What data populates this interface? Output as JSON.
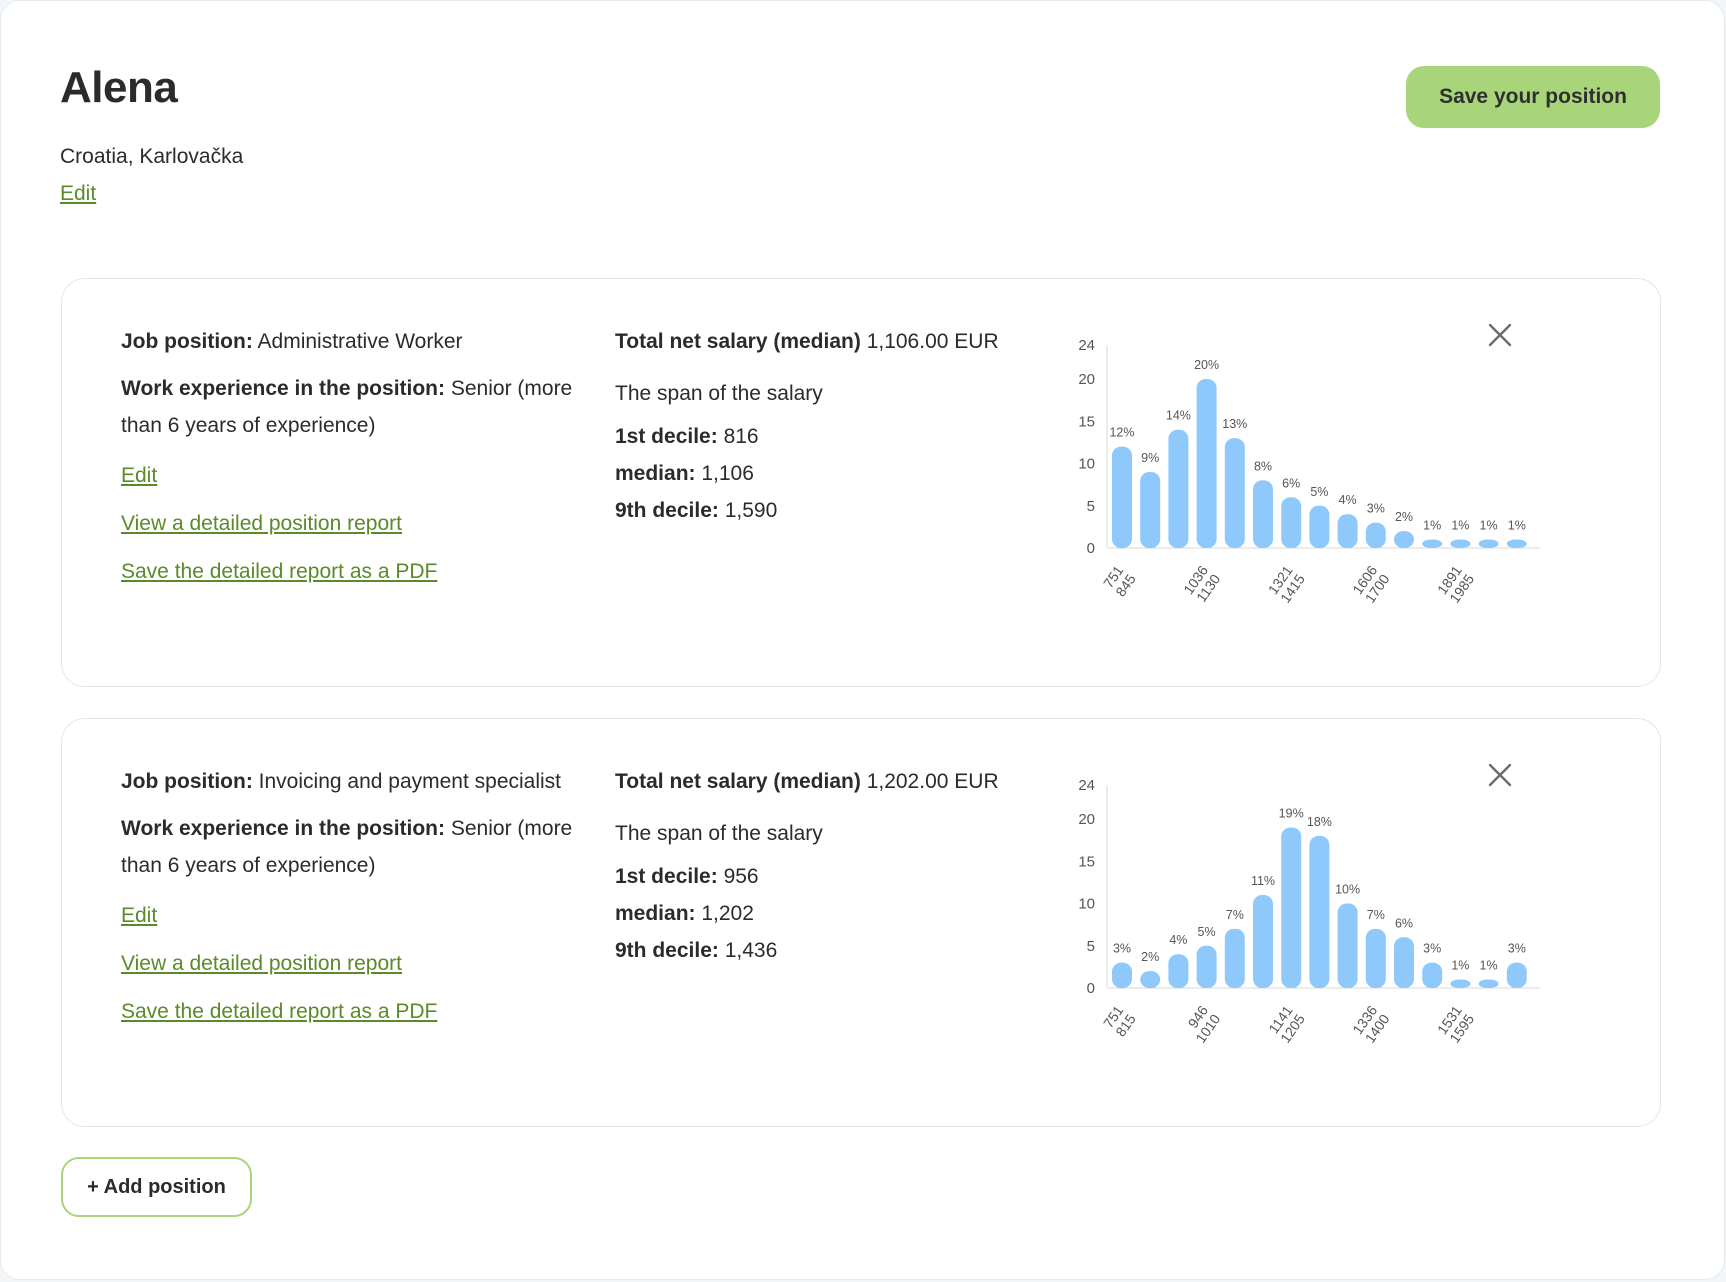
{
  "profile": {
    "name": "Alena",
    "location": "Croatia, Karlovačka",
    "edit_label": "Edit",
    "save_label": "Save your position"
  },
  "positions": [
    {
      "job_label": "Job position:",
      "job_value": "Administrative Worker",
      "exp_label": "Work experience in the position:",
      "exp_value": "Senior (more than 6 years of experience)",
      "edit_label": "Edit",
      "view_report_label": "View a detailed position report",
      "save_pdf_label": "Save the detailed report as a PDF",
      "median_label": "Total net salary (median)",
      "median_value": "1,106.00 EUR",
      "span_title": "The span of the salary",
      "decile1_label": "1st decile:",
      "decile1_value": "816",
      "median2_label": "median:",
      "median2_value": "1,106",
      "decile9_label": "9th decile:",
      "decile9_value": "1,590"
    },
    {
      "job_label": "Job position:",
      "job_value": "Invoicing and payment specialist",
      "exp_label": "Work experience in the position:",
      "exp_value": "Senior (more than 6 years of experience)",
      "edit_label": "Edit",
      "view_report_label": "View a detailed position report",
      "save_pdf_label": "Save the detailed report as a PDF",
      "median_label": "Total net salary (median)",
      "median_value": "1,202.00 EUR",
      "span_title": "The span of the salary",
      "decile1_label": "1st decile:",
      "decile1_value": "956",
      "median2_label": "median:",
      "median2_value": "1,202",
      "decile9_label": "9th decile:",
      "decile9_value": "1,436"
    }
  ],
  "add_position_label": "+ Add position",
  "icons": {
    "close": "close-icon"
  },
  "colors": {
    "accent": "#a9d57a",
    "link": "#5a8a2a",
    "bar": "#8fc8fb"
  },
  "chart_data": [
    {
      "type": "bar",
      "ylim": [
        0,
        24
      ],
      "yticks": [
        0,
        5,
        10,
        15,
        20,
        24
      ],
      "values": [
        12,
        9,
        14,
        20,
        13,
        8,
        6,
        5,
        4,
        3,
        2,
        1,
        1,
        1,
        1
      ],
      "labels": [
        "12%",
        "9%",
        "14%",
        "20%",
        "13%",
        "8%",
        "6%",
        "5%",
        "4%",
        "3%",
        "2%",
        "1%",
        "1%",
        "1%",
        "1%"
      ],
      "xticks": [
        {
          "index": 0,
          "lines": [
            "751",
            "845"
          ]
        },
        {
          "index": 3,
          "lines": [
            "1036",
            "1130"
          ]
        },
        {
          "index": 6,
          "lines": [
            "1321",
            "1415"
          ]
        },
        {
          "index": 9,
          "lines": [
            "1606",
            "1700"
          ]
        },
        {
          "index": 12,
          "lines": [
            "1891",
            "1985"
          ]
        }
      ]
    },
    {
      "type": "bar",
      "ylim": [
        0,
        24
      ],
      "yticks": [
        0,
        5,
        10,
        15,
        20,
        24
      ],
      "values": [
        3,
        2,
        4,
        5,
        7,
        11,
        19,
        18,
        10,
        7,
        6,
        3,
        1,
        1,
        3
      ],
      "labels": [
        "3%",
        "2%",
        "4%",
        "5%",
        "7%",
        "11%",
        "19%",
        "18%",
        "10%",
        "7%",
        "6%",
        "3%",
        "1%",
        "1%",
        "3%"
      ],
      "xticks": [
        {
          "index": 0,
          "lines": [
            "751",
            "815"
          ]
        },
        {
          "index": 3,
          "lines": [
            "946",
            "1010"
          ]
        },
        {
          "index": 6,
          "lines": [
            "1141",
            "1205"
          ]
        },
        {
          "index": 9,
          "lines": [
            "1336",
            "1400"
          ]
        },
        {
          "index": 12,
          "lines": [
            "1531",
            "1595"
          ]
        }
      ]
    }
  ]
}
